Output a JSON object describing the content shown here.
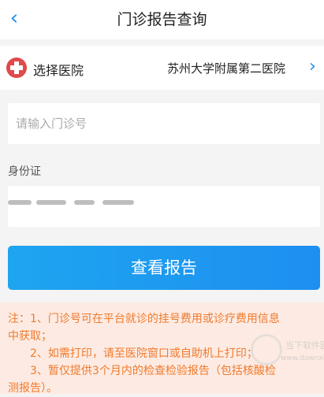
{
  "header": {
    "title": "门诊报告查询",
    "back_icon": "chevron-left-icon"
  },
  "hospital": {
    "icon": "medical-cross-icon",
    "label": "选择医院",
    "value": "苏州大学附属第二医院"
  },
  "clinic_number": {
    "placeholder": "请输入门诊号",
    "value": ""
  },
  "id_card": {
    "label": "身份证",
    "value": "(masked)"
  },
  "query_button": {
    "label": "查看报告"
  },
  "notes": {
    "line1": "注：1、门诊号可在平台就诊的挂号费用或诊疗费用信息",
    "line2": "中获取；",
    "line3": "2、如需打印，请至医院窗口或自助机上打印；",
    "line4": "3、暂仅提供3个月内的检查检验报告（包括核酸检",
    "line5": "测报告）。"
  },
  "watermark": {
    "name": "当下软件园",
    "url": "www.downxia.com"
  },
  "colors": {
    "accent": "#1e8ff0",
    "note_text": "#f07a2c",
    "note_bg": "#fdebe3",
    "hospital_icon": "#e04a4a"
  }
}
